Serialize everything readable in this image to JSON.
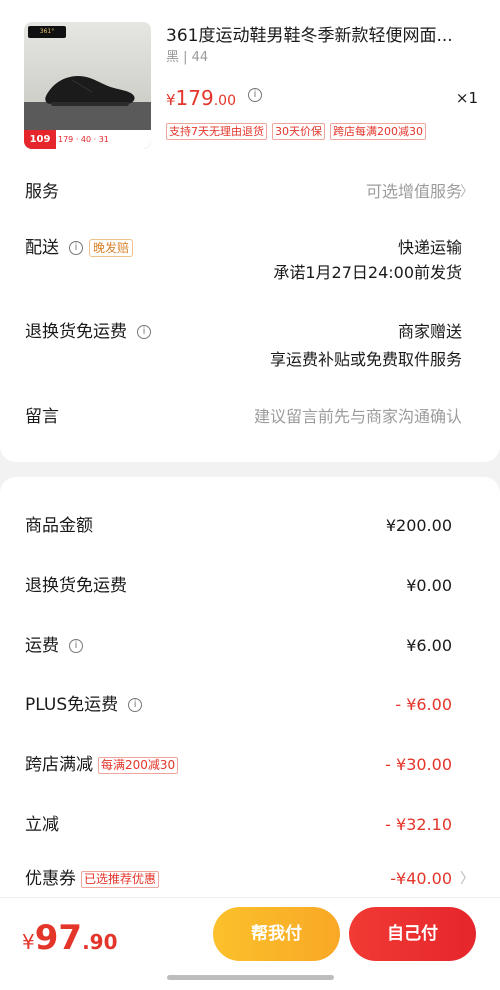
{
  "product": {
    "brand_mark": "361°",
    "thumb_promo_price": "109",
    "thumb_promo_text": "179 · 40 · 31",
    "title": "361度运动鞋男鞋冬季新款轻便网面...",
    "spec": "黑 | 44",
    "price_currency": "¥",
    "price_int": "179",
    "price_dec": ".00",
    "qty": "×1",
    "tags": [
      "支持7天无理由退货",
      "30天价保",
      "跨店每满200减30"
    ]
  },
  "service": {
    "label": "服务",
    "value": "可选增值服务"
  },
  "delivery": {
    "label": "配送",
    "badge": "晚发赔",
    "line1": "快递运输",
    "line2": "承诺1月27日24:00前发货"
  },
  "return_shipping": {
    "label": "退换货免运费",
    "line1": "商家赠送",
    "line2": "享运费补贴或免费取件服务"
  },
  "message": {
    "label": "留言",
    "placeholder": "建议留言前先与商家沟通确认"
  },
  "fees": {
    "goods_amount": {
      "label": "商品金额",
      "value": "¥200.00"
    },
    "return_free": {
      "label": "退换货免运费",
      "value": "¥0.00"
    },
    "shipping": {
      "label": "运费",
      "value": "¥6.00"
    },
    "plus_free": {
      "label": "PLUS免运费",
      "value": "- ¥6.00"
    },
    "cross_store": {
      "label": "跨店满减",
      "tag": "每满200减30",
      "value": "- ¥30.00"
    },
    "instant": {
      "label": "立减",
      "value": "- ¥32.10"
    },
    "coupon": {
      "label": "优惠券",
      "tag": "已选推荐优惠",
      "value": "-¥40.00"
    }
  },
  "footer": {
    "total_currency": "¥",
    "total_int": "97",
    "total_dec": ".90",
    "help_pay_label": "帮我付",
    "pay_label": "自己付"
  },
  "icons": {
    "info": "info-icon",
    "chevron": "chevron-right-icon"
  },
  "colors": {
    "accent_red": "#e4352a",
    "help_button": "#fbc12b",
    "pay_button": "#e5262c"
  }
}
